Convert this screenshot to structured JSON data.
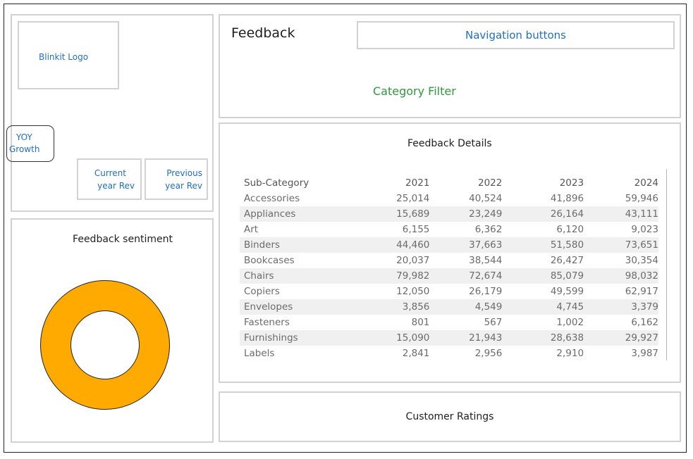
{
  "logo": {
    "label": "Blinkit Logo"
  },
  "yoy": {
    "label_line1": "YOY",
    "label_line2": "Growth"
  },
  "kpis": {
    "current": {
      "line1": "Current",
      "line2": "year Rev"
    },
    "previous": {
      "line1": "Previous",
      "line2": "year Rev"
    }
  },
  "header": {
    "title": "Feedback",
    "nav_label": "Navigation buttons",
    "filter_label": "Category Filter"
  },
  "sentiment": {
    "title": "Feedback sentiment",
    "ring_color": "#ffaa00"
  },
  "details": {
    "title": "Feedback Details",
    "columns": [
      "Sub-Category",
      "2021",
      "2022",
      "2023",
      "2024"
    ],
    "rows": [
      [
        "Accessories",
        "25,014",
        "40,524",
        "41,896",
        "59,946"
      ],
      [
        "Appliances",
        "15,689",
        "23,249",
        "26,164",
        "43,111"
      ],
      [
        "Art",
        "6,155",
        "6,362",
        "6,120",
        "9,023"
      ],
      [
        "Binders",
        "44,460",
        "37,663",
        "51,580",
        "73,651"
      ],
      [
        "Bookcases",
        "20,037",
        "38,544",
        "26,427",
        "30,354"
      ],
      [
        "Chairs",
        "79,982",
        "72,674",
        "85,079",
        "98,032"
      ],
      [
        "Copiers",
        "12,050",
        "26,179",
        "49,599",
        "62,917"
      ],
      [
        "Envelopes",
        "3,856",
        "4,549",
        "4,745",
        "3,379"
      ],
      [
        "Fasteners",
        "801",
        "567",
        "1,002",
        "6,162"
      ],
      [
        "Furnishings",
        "15,090",
        "21,943",
        "28,638",
        "29,927"
      ],
      [
        "Labels",
        "2,841",
        "2,956",
        "2,910",
        "3,987"
      ]
    ]
  },
  "ratings": {
    "title": "Customer Ratings"
  }
}
